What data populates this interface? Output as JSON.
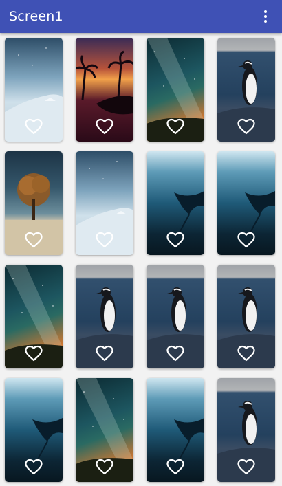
{
  "app": {
    "title": "Screen1"
  },
  "toolbar": {
    "menu_icon": "more-vert-icon"
  },
  "grid": {
    "favorite_icon": "heart-outline-icon",
    "items": [
      {
        "image": "snowy-hill-night"
      },
      {
        "image": "palm-trees-sunset"
      },
      {
        "image": "milky-way-sky"
      },
      {
        "image": "penguin-on-rock"
      },
      {
        "image": "lone-tree-field"
      },
      {
        "image": "snowy-hill-night"
      },
      {
        "image": "manta-ray"
      },
      {
        "image": "manta-ray"
      },
      {
        "image": "milky-way-sky"
      },
      {
        "image": "penguin-on-rock"
      },
      {
        "image": "penguin-on-rock"
      },
      {
        "image": "penguin-on-rock"
      },
      {
        "image": "manta-ray"
      },
      {
        "image": "milky-way-sky"
      },
      {
        "image": "manta-ray"
      },
      {
        "image": "penguin-on-rock"
      }
    ]
  },
  "colors": {
    "app_bar": "#3f51b5",
    "background": "#f2f2f2",
    "icon": "#ffffff"
  }
}
